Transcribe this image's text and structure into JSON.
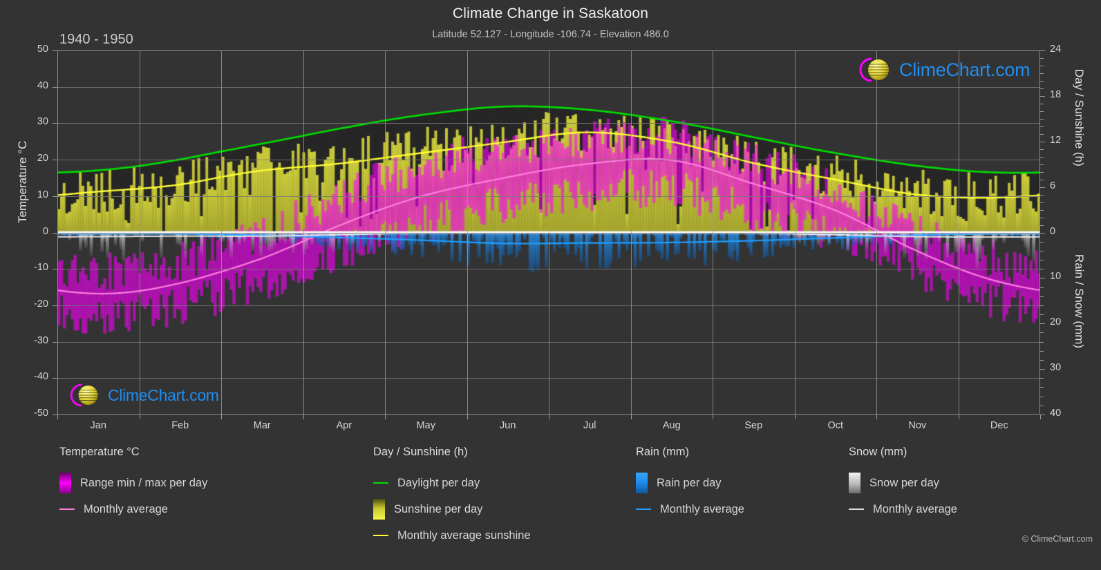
{
  "header": {
    "title": "Climate Change in Saskatoon",
    "subtitle": "Latitude 52.127 - Longitude -106.74 - Elevation 486.0",
    "period": "1940 - 1950"
  },
  "copyright": "© ClimeChart.com",
  "watermark": {
    "text": "ClimeChart.com"
  },
  "axes": {
    "left_label": "Temperature °C",
    "right_label_top": "Day / Sunshine (h)",
    "right_label_bottom": "Rain / Snow (mm)",
    "left_ticks": [
      "50",
      "40",
      "30",
      "20",
      "10",
      "0",
      "-10",
      "-20",
      "-30",
      "-40",
      "-50"
    ],
    "right_ticks_top": [
      "24",
      "18",
      "12",
      "6",
      "0"
    ],
    "right_ticks_bottom": [
      "0",
      "10",
      "20",
      "30",
      "40"
    ],
    "x_ticks": [
      "Jan",
      "Feb",
      "Mar",
      "Apr",
      "May",
      "Jun",
      "Jul",
      "Aug",
      "Sep",
      "Oct",
      "Nov",
      "Dec"
    ]
  },
  "legend": {
    "groups": [
      {
        "title": "Temperature °C",
        "items": [
          {
            "label": "Range min / max per day",
            "marker": "bar",
            "color": "#ff00ff"
          },
          {
            "label": "Monthly average",
            "marker": "line",
            "color": "#ff7fe0"
          }
        ]
      },
      {
        "title": "Day / Sunshine (h)",
        "items": [
          {
            "label": "Daylight per day",
            "marker": "line",
            "color": "#00e000"
          },
          {
            "label": "Sunshine per day",
            "marker": "bar",
            "color": "#f0f000"
          },
          {
            "label": "Monthly average sunshine",
            "marker": "line",
            "color": "#ffff33"
          }
        ]
      },
      {
        "title": "Rain (mm)",
        "items": [
          {
            "label": "Rain per day",
            "marker": "bar",
            "color": "#1f8ef1"
          },
          {
            "label": "Monthly average",
            "marker": "line",
            "color": "#1f9eff"
          }
        ]
      },
      {
        "title": "Snow (mm)",
        "items": [
          {
            "label": "Snow per day",
            "marker": "bar",
            "color": "#e8e8e8"
          },
          {
            "label": "Monthly average",
            "marker": "line",
            "color": "#e0e0e0"
          }
        ]
      }
    ]
  },
  "colors": {
    "background": "#333333",
    "grid": "#7d7d7d",
    "zero_line": "#f2f2f2",
    "temp_range": "#ff00ff",
    "temp_avg": "#ff7fe0",
    "daylight": "#00e000",
    "sunshine": "#d8d838",
    "sunshine_avg": "#ffff33",
    "rain": "#1f8ef1",
    "rain_avg": "#1f9eff",
    "snow": "#cccccc",
    "night": "#2b2b2b"
  },
  "chart_data": {
    "type": "area",
    "title": "Climate Change in Saskatoon",
    "subtitle": "Latitude 52.127 - Longitude -106.74 - Elevation 486.0",
    "xlabel": "",
    "ylabel": "Temperature °C",
    "ylim": [
      -50,
      50
    ],
    "y2lim_top": [
      0,
      24
    ],
    "y2lim_bottom": [
      0,
      40
    ],
    "grid": true,
    "legend_position": "below",
    "categories": [
      "Jan",
      "Feb",
      "Mar",
      "Apr",
      "May",
      "Jun",
      "Jul",
      "Aug",
      "Sep",
      "Oct",
      "Nov",
      "Dec"
    ],
    "series": [
      {
        "name": "Monthly average temperature (°C)",
        "axis": "left",
        "color": "#ff7fe0",
        "values": [
          -16.8,
          -14.0,
          -7.5,
          2.0,
          10.0,
          15.0,
          18.8,
          19.9,
          13.5,
          6.2,
          -5.0,
          -13.5
        ]
      },
      {
        "name": "Monthly average max temperature (°C)",
        "axis": "left",
        "color": "#ff00ff",
        "values": [
          -11.0,
          -8.0,
          -1.0,
          10.0,
          18.5,
          23.0,
          26.0,
          26.5,
          19.5,
          12.0,
          0.5,
          -8.0
        ]
      },
      {
        "name": "Monthly average min temperature (°C)",
        "axis": "left",
        "color": "#ff00ff",
        "values": [
          -22.5,
          -20.0,
          -14.0,
          -5.0,
          2.0,
          7.5,
          11.0,
          11.5,
          5.5,
          -0.5,
          -10.0,
          -19.0
        ]
      },
      {
        "name": "Daylight per day (h)",
        "axis": "right_top",
        "color": "#00e000",
        "values": [
          8.2,
          9.6,
          11.6,
          13.7,
          15.5,
          16.6,
          16.2,
          14.7,
          12.6,
          10.5,
          8.8,
          7.9
        ]
      },
      {
        "name": "Monthly average sunshine (h)",
        "axis": "right_top",
        "color": "#ffff33",
        "values": [
          5.4,
          6.3,
          8.1,
          9.1,
          10.5,
          11.9,
          13.2,
          12.0,
          9.2,
          7.0,
          5.0,
          4.6
        ]
      },
      {
        "name": "Monthly average rain (mm)",
        "axis": "right_bottom",
        "color": "#1f9eff",
        "values": [
          0.3,
          0.3,
          0.6,
          1.1,
          1.7,
          2.4,
          2.3,
          2.2,
          1.8,
          1.2,
          0.6,
          0.3
        ]
      },
      {
        "name": "Monthly average snow (mm)",
        "axis": "right_bottom",
        "color": "#e0e0e0",
        "values": [
          0.9,
          0.8,
          0.8,
          0.5,
          0.1,
          0.0,
          0.0,
          0.0,
          0.1,
          0.5,
          0.9,
          1.0
        ]
      }
    ]
  }
}
